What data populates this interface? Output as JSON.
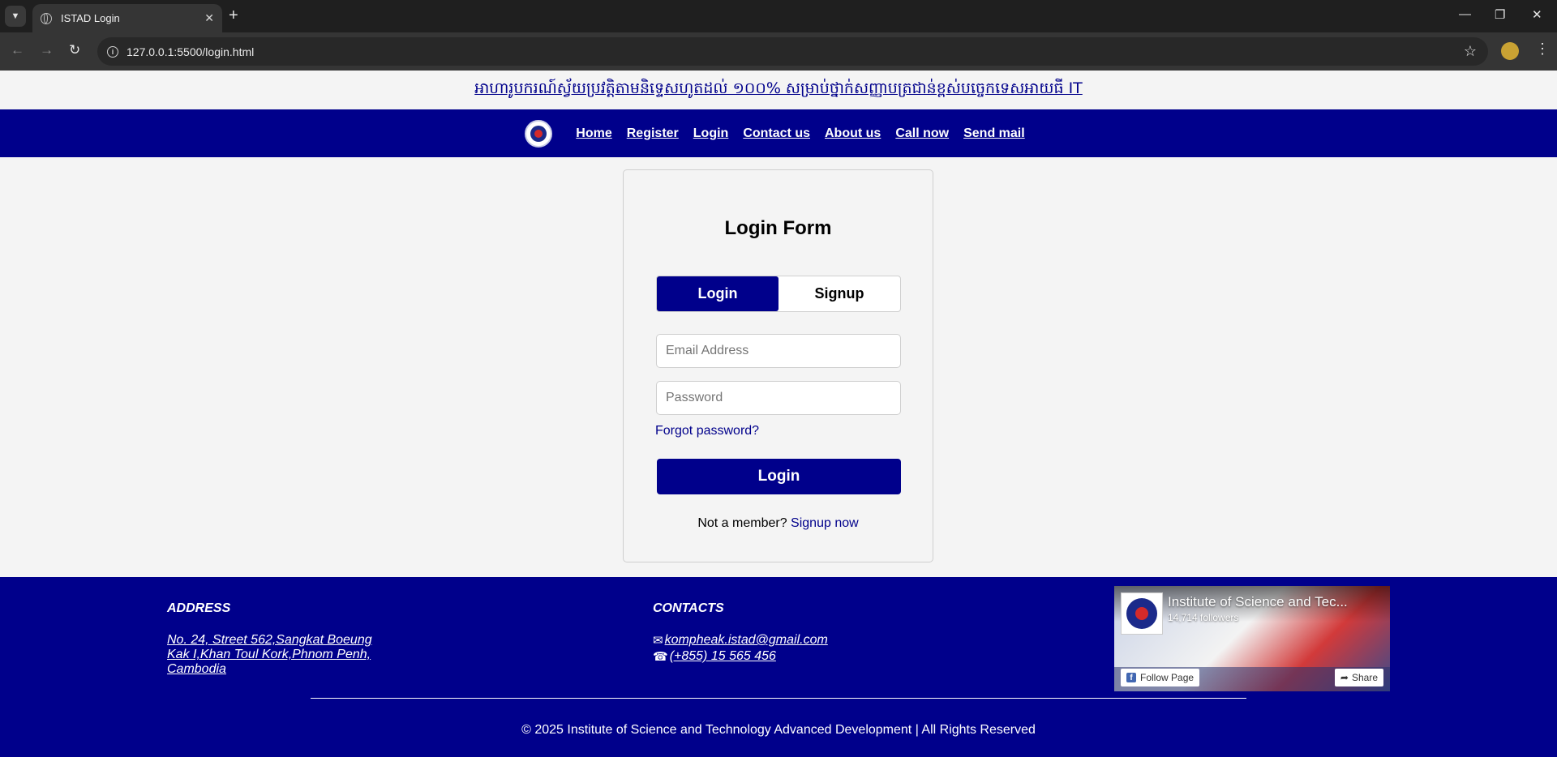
{
  "browser": {
    "tab_title": "ISTAD Login",
    "url": "127.0.0.1:5500/login.html"
  },
  "announcement": "អាហារូបករណ៍ស្វ័យប្រវត្តិតាមនិទ្ទេសហូតដល់ ១០០% សម្រាប់ថ្នាក់សញ្ញាបត្រជាន់ខ្ពស់បច្ចេកទេសអាយធី IT",
  "nav": {
    "items": [
      {
        "label": "Home"
      },
      {
        "label": "Register"
      },
      {
        "label": "Login"
      },
      {
        "label": "Contact us"
      },
      {
        "label": "About us"
      },
      {
        "label": "Call now"
      },
      {
        "label": "Send mail"
      }
    ]
  },
  "login_form": {
    "title": "Login Form",
    "toggle_login": "Login",
    "toggle_signup": "Signup",
    "email_placeholder": "Email Address",
    "email_value": "",
    "password_placeholder": "Password",
    "password_value": "",
    "forgot": "Forgot password?",
    "submit": "Login",
    "member_text": "Not a member?",
    "signup_link": "Signup now"
  },
  "footer": {
    "address_heading": "ADDRESS",
    "address": "No. 24, Street 562,Sangkat Boeung Kak I,Khan Toul Kork,Phnom Penh, Cambodia",
    "contacts_heading": "CONTACTS",
    "email": "kompheak.istad@gmail.com",
    "phone": "(+855) 15 565 456",
    "copyright": "© 2025 Institute of Science and Technology Advanced Development | All Rights Reserved"
  },
  "facebook_widget": {
    "page_name": "Institute of Science and Tec...",
    "followers": "14,714 followers",
    "follow_button": "Follow Page",
    "share_button": "Share"
  },
  "colors": {
    "brand_navy": "#00008b",
    "page_background": "#f4f4f4"
  }
}
